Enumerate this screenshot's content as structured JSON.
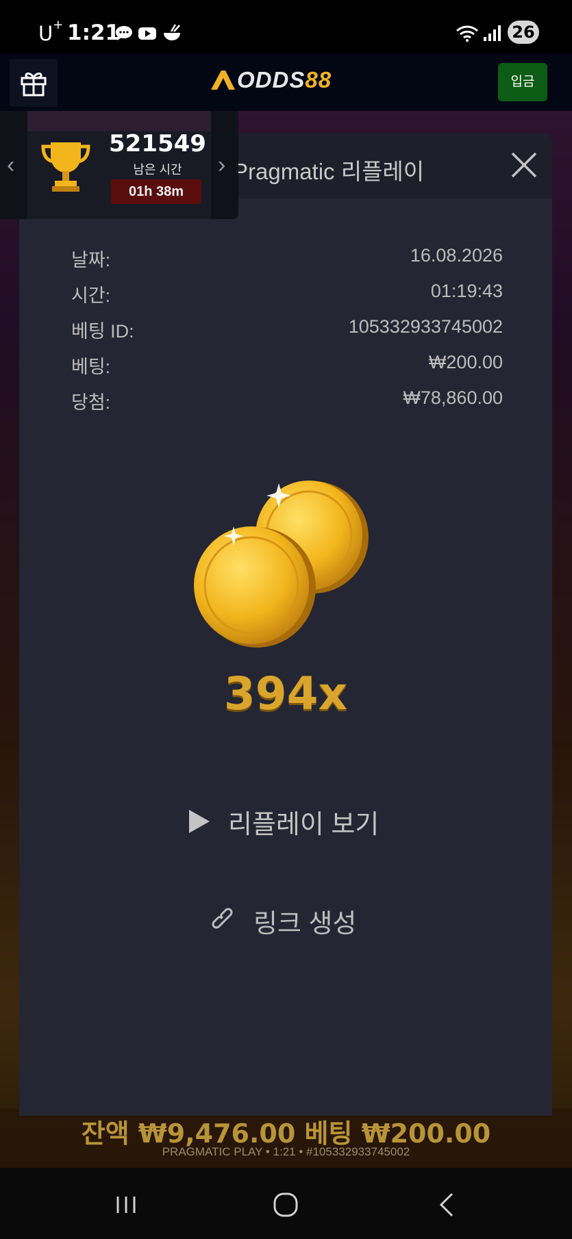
{
  "status_bar": {
    "carrier": "U",
    "carrier_sup": "+",
    "time": "1:21",
    "battery": "26"
  },
  "header": {
    "logo_text": "ODDS",
    "logo_number": "88",
    "deposit_label": "입금"
  },
  "tournament": {
    "points": "521549",
    "time_left_label": "남은 시간",
    "timer": "01h 38m"
  },
  "modal": {
    "title": "Pragmatic 리플레이",
    "rows": [
      {
        "label": "날짜:",
        "value": "16.08.2026"
      },
      {
        "label": "시간:",
        "value": "01:19:43"
      },
      {
        "label": "베팅 ID:",
        "value": "105332933745002"
      },
      {
        "label": "베팅:",
        "value": "₩200.00"
      },
      {
        "label": "당첨:",
        "value": "₩78,860.00"
      }
    ],
    "multiplier": "394x",
    "replay_label": "리플레이 보기",
    "link_label": "링크 생성"
  },
  "game": {
    "balance_text": "잔액 ₩9,476.00   베팅 ₩200.00",
    "footer_info": "PRAGMATIC PLAY • 1:21 • #105332933745002"
  },
  "colors": {
    "accent_gold": "#f2b124",
    "deposit_green": "#0d5c15",
    "modal_bg": "#242633",
    "timer_red": "#5a0d0d"
  },
  "icons": [
    "gift-icon",
    "close-icon",
    "trophy-icon",
    "coins-icon",
    "play-icon",
    "link-icon",
    "chevron-left-icon",
    "chevron-right-icon",
    "wifi-icon",
    "signal-icon",
    "chat-icon",
    "youtube-icon",
    "bowl-icon",
    "nav-recents-icon",
    "nav-home-icon",
    "nav-back-icon"
  ]
}
